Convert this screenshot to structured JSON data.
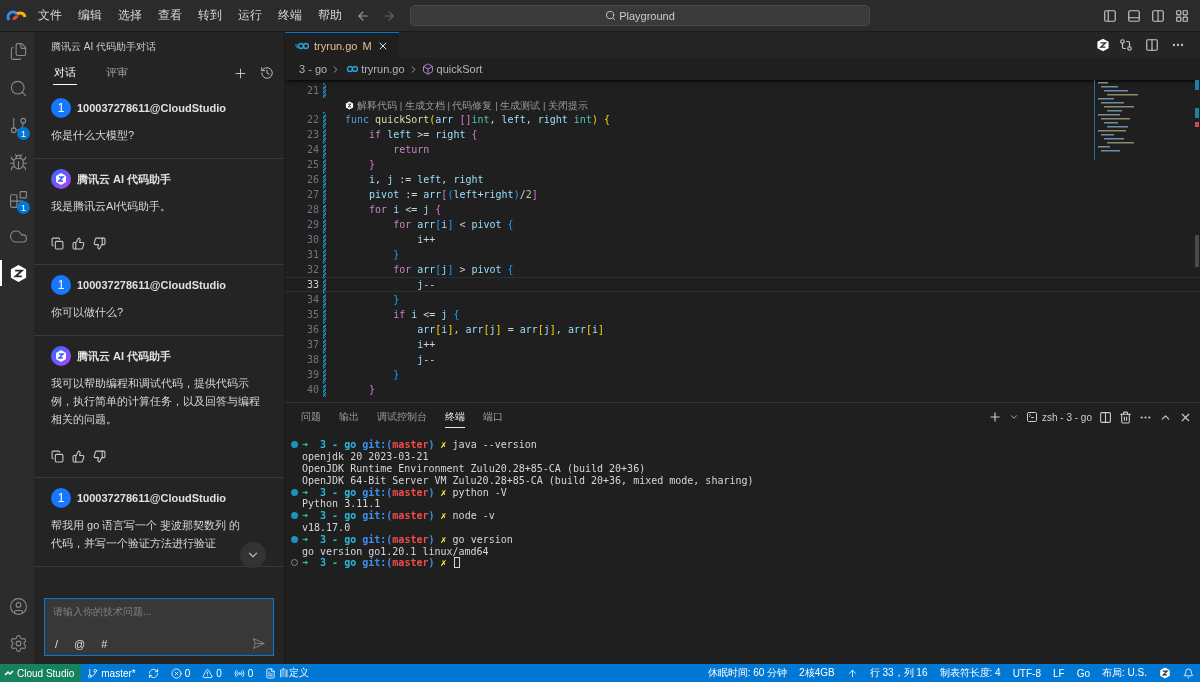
{
  "menu_bar": {
    "items": [
      "文件",
      "编辑",
      "选择",
      "查看",
      "转到",
      "运行",
      "终端",
      "帮助"
    ],
    "search": {
      "value": "Playground"
    }
  },
  "activity_bar": {
    "items": [
      {
        "kind": "files",
        "selected": false
      },
      {
        "kind": "search",
        "selected": false
      },
      {
        "kind": "source-control",
        "selected": false,
        "badge": "1"
      },
      {
        "kind": "run",
        "selected": false
      },
      {
        "kind": "extensions",
        "selected": false,
        "badge": "1"
      },
      {
        "kind": "cloud",
        "selected": false
      },
      {
        "kind": "assistant",
        "selected": true
      }
    ],
    "bottom": [
      {
        "kind": "account"
      },
      {
        "kind": "settings"
      }
    ]
  },
  "chat": {
    "title": "腾讯云 AI 代码助手对话",
    "tabs": [
      {
        "label": "对话",
        "selected": true
      },
      {
        "label": "评审",
        "selected": false
      }
    ],
    "messages": [
      {
        "kind": "user",
        "avatar": "1",
        "author": "100037278611@CloudStudio",
        "lines": [
          "你是什么大模型?"
        ]
      },
      {
        "kind": "assistant",
        "author": "腾讯云 AI 代码助手",
        "lines": [
          "我是腾讯云AI代码助手。"
        ]
      },
      {
        "kind": "user",
        "avatar": "1",
        "author": "100037278611@CloudStudio",
        "lines": [
          "你可以做什么?"
        ]
      },
      {
        "kind": "assistant",
        "author": "腾讯云 AI 代码助手",
        "lines": [
          "我可以帮助编程和调试代码，提供代码示",
          "例，执行简单的计算任务，以及回答与编程",
          "相关的问题。"
        ]
      },
      {
        "kind": "user",
        "avatar": "1",
        "author": "100037278611@CloudStudio",
        "lines": [
          "帮我用 go 语言写一个 斐波那契数列 的",
          "代码，并写一个验证方法进行验证"
        ]
      }
    ],
    "input": {
      "placeholder": "请输入你的技术问题...",
      "shortcuts": [
        "/",
        "@",
        "#"
      ]
    }
  },
  "editor": {
    "tabs": [
      {
        "name": "tryrun.go",
        "status": "M",
        "selected": true
      }
    ],
    "breadcrumb": [
      "3 - go",
      "tryrun.go",
      "quickSort"
    ],
    "lines": [
      {
        "number": "21",
        "selected": false,
        "lens": "解释代码 | 生成文档 | 代码修复 | 生成测试 | 关闭提示"
      },
      {
        "number": "22",
        "selected": false,
        "tokens": [
          {
            "text": "func ",
            "kind": "kw"
          },
          {
            "text": "quickSort",
            "kind": "fn"
          },
          {
            "text": "(",
            "kind": "b1"
          },
          {
            "text": "arr ",
            "kind": "id"
          },
          {
            "text": "[]",
            "kind": "b2"
          },
          {
            "text": "int",
            "kind": "type"
          },
          {
            "text": ", ",
            "kind": "op"
          },
          {
            "text": "left",
            "kind": "id"
          },
          {
            "text": ", ",
            "kind": "op"
          },
          {
            "text": "right ",
            "kind": "id"
          },
          {
            "text": "int",
            "kind": "type"
          },
          {
            "text": ")",
            "kind": "b1"
          },
          {
            "text": " {",
            "kind": "b1"
          }
        ]
      },
      {
        "number": "23",
        "selected": false,
        "tokens": [
          {
            "text": "    if ",
            "kind": "ctl"
          },
          {
            "text": "left ",
            "kind": "id"
          },
          {
            "text": ">= ",
            "kind": "op"
          },
          {
            "text": "right ",
            "kind": "id"
          },
          {
            "text": "{",
            "kind": "b2"
          }
        ]
      },
      {
        "number": "24",
        "selected": false,
        "tokens": [
          {
            "text": "        return",
            "kind": "ctl"
          }
        ]
      },
      {
        "number": "25",
        "selected": false,
        "tokens": [
          {
            "text": "    }",
            "kind": "b2"
          }
        ]
      },
      {
        "number": "26",
        "selected": false,
        "tokens": [
          {
            "text": "    i",
            "kind": "id"
          },
          {
            "text": ", ",
            "kind": "op"
          },
          {
            "text": "j ",
            "kind": "id"
          },
          {
            "text": ":= ",
            "kind": "op"
          },
          {
            "text": "left",
            "kind": "id"
          },
          {
            "text": ", ",
            "kind": "op"
          },
          {
            "text": "right",
            "kind": "id"
          }
        ]
      },
      {
        "number": "27",
        "selected": false,
        "tokens": [
          {
            "text": "    pivot ",
            "kind": "id"
          },
          {
            "text": ":= ",
            "kind": "op"
          },
          {
            "text": "arr",
            "kind": "id"
          },
          {
            "text": "[",
            "kind": "b2"
          },
          {
            "text": "(",
            "kind": "b3"
          },
          {
            "text": "left",
            "kind": "id"
          },
          {
            "text": "+",
            "kind": "op"
          },
          {
            "text": "right",
            "kind": "id"
          },
          {
            "text": ")",
            "kind": "b3"
          },
          {
            "text": "/",
            "kind": "op"
          },
          {
            "text": "2",
            "kind": "num"
          },
          {
            "text": "]",
            "kind": "b2"
          }
        ]
      },
      {
        "number": "28",
        "selected": false,
        "tokens": [
          {
            "text": "    for ",
            "kind": "ctl"
          },
          {
            "text": "i ",
            "kind": "id"
          },
          {
            "text": "<= ",
            "kind": "op"
          },
          {
            "text": "j ",
            "kind": "id"
          },
          {
            "text": "{",
            "kind": "b2"
          }
        ]
      },
      {
        "number": "29",
        "selected": false,
        "tokens": [
          {
            "text": "        for ",
            "kind": "ctl"
          },
          {
            "text": "arr",
            "kind": "id"
          },
          {
            "text": "[",
            "kind": "b3"
          },
          {
            "text": "i",
            "kind": "id"
          },
          {
            "text": "]",
            "kind": "b3"
          },
          {
            "text": " < ",
            "kind": "op"
          },
          {
            "text": "pivot ",
            "kind": "id"
          },
          {
            "text": "{",
            "kind": "b3"
          }
        ]
      },
      {
        "number": "30",
        "selected": false,
        "tokens": [
          {
            "text": "            i",
            "kind": "id"
          },
          {
            "text": "++",
            "kind": "op"
          }
        ]
      },
      {
        "number": "31",
        "selected": false,
        "tokens": [
          {
            "text": "        }",
            "kind": "b3"
          }
        ]
      },
      {
        "number": "32",
        "selected": false,
        "tokens": [
          {
            "text": "        for ",
            "kind": "ctl"
          },
          {
            "text": "arr",
            "kind": "id"
          },
          {
            "text": "[",
            "kind": "b3"
          },
          {
            "text": "j",
            "kind": "id"
          },
          {
            "text": "]",
            "kind": "b3"
          },
          {
            "text": " > ",
            "kind": "op"
          },
          {
            "text": "pivot ",
            "kind": "id"
          },
          {
            "text": "{",
            "kind": "b3"
          }
        ]
      },
      {
        "number": "33",
        "selected": true,
        "tokens": [
          {
            "text": "            j",
            "kind": "id"
          },
          {
            "text": "--",
            "kind": "op"
          }
        ]
      },
      {
        "number": "34",
        "selected": false,
        "tokens": [
          {
            "text": "        }",
            "kind": "b3"
          }
        ]
      },
      {
        "number": "35",
        "selected": false,
        "tokens": [
          {
            "text": "        if ",
            "kind": "ctl"
          },
          {
            "text": "i ",
            "kind": "id"
          },
          {
            "text": "<= ",
            "kind": "op"
          },
          {
            "text": "j ",
            "kind": "id"
          },
          {
            "text": "{",
            "kind": "b3"
          }
        ]
      },
      {
        "number": "36",
        "selected": false,
        "tokens": [
          {
            "text": "            arr",
            "kind": "id"
          },
          {
            "text": "[",
            "kind": "b1"
          },
          {
            "text": "i",
            "kind": "id"
          },
          {
            "text": "]",
            "kind": "b1"
          },
          {
            "text": ", ",
            "kind": "op"
          },
          {
            "text": "arr",
            "kind": "id"
          },
          {
            "text": "[",
            "kind": "b1"
          },
          {
            "text": "j",
            "kind": "id"
          },
          {
            "text": "]",
            "kind": "b1"
          },
          {
            "text": " = ",
            "kind": "op"
          },
          {
            "text": "arr",
            "kind": "id"
          },
          {
            "text": "[",
            "kind": "b1"
          },
          {
            "text": "j",
            "kind": "id"
          },
          {
            "text": "]",
            "kind": "b1"
          },
          {
            "text": ", ",
            "kind": "op"
          },
          {
            "text": "arr",
            "kind": "id"
          },
          {
            "text": "[",
            "kind": "b1"
          },
          {
            "text": "i",
            "kind": "id"
          },
          {
            "text": "]",
            "kind": "b1"
          }
        ]
      },
      {
        "number": "37",
        "selected": false,
        "tokens": [
          {
            "text": "            i",
            "kind": "id"
          },
          {
            "text": "++",
            "kind": "op"
          }
        ]
      },
      {
        "number": "38",
        "selected": false,
        "tokens": [
          {
            "text": "            j",
            "kind": "id"
          },
          {
            "text": "--",
            "kind": "op"
          }
        ]
      },
      {
        "number": "39",
        "selected": false,
        "tokens": [
          {
            "text": "        }",
            "kind": "b3"
          }
        ]
      },
      {
        "number": "40",
        "selected": false,
        "tokens": [
          {
            "text": "    }",
            "kind": "b2"
          }
        ]
      }
    ]
  },
  "panel": {
    "tabs": [
      {
        "label": "问题",
        "selected": false
      },
      {
        "label": "输出",
        "selected": false
      },
      {
        "label": "调试控制台",
        "selected": false
      },
      {
        "label": "终端",
        "selected": true
      },
      {
        "label": "端口",
        "selected": false
      }
    ],
    "terminal_name": "zsh - 3 - go",
    "lines": [
      {
        "kind": "prompt",
        "finished": true,
        "arrow": "➜",
        "dir": "3 - go",
        "git": "git:(",
        "branch": "master",
        "git_end": ")",
        "dirty": "✗",
        "command": "java --version"
      },
      {
        "kind": "output",
        "text": "openjdk 20 2023-03-21"
      },
      {
        "kind": "output",
        "text": "OpenJDK Runtime Environment Zulu20.28+85-CA (build 20+36)"
      },
      {
        "kind": "output",
        "text": "OpenJDK 64-Bit Server VM Zulu20.28+85-CA (build 20+36, mixed mode, sharing)"
      },
      {
        "kind": "prompt",
        "finished": true,
        "arrow": "➜",
        "dir": "3 - go",
        "git": "git:(",
        "branch": "master",
        "git_end": ")",
        "dirty": "✗",
        "command": "python -V"
      },
      {
        "kind": "output",
        "text": "Python 3.11.1"
      },
      {
        "kind": "prompt",
        "finished": true,
        "arrow": "➜",
        "dir": "3 - go",
        "git": "git:(",
        "branch": "master",
        "git_end": ")",
        "dirty": "✗",
        "command": "node -v"
      },
      {
        "kind": "output",
        "text": "v18.17.0"
      },
      {
        "kind": "prompt",
        "finished": true,
        "arrow": "➜",
        "dir": "3 - go",
        "git": "git:(",
        "branch": "master",
        "git_end": ")",
        "dirty": "✗",
        "command": "go version"
      },
      {
        "kind": "output",
        "text": "go version go1.20.1 linux/amd64"
      },
      {
        "kind": "prompt",
        "finished": false,
        "arrow": "➜",
        "dir": "3 - go",
        "git": "git:(",
        "branch": "master",
        "git_end": ")",
        "dirty": "✗",
        "cursor": true
      }
    ]
  },
  "status_bar": {
    "left": [
      {
        "kind": "remote",
        "text": "Cloud Studio"
      },
      {
        "kind": "branch",
        "text": "master*"
      },
      {
        "kind": "sync"
      },
      {
        "kind": "errors",
        "text": "0"
      },
      {
        "kind": "warnings",
        "text": "0"
      },
      {
        "kind": "ports",
        "text": "0"
      },
      {
        "kind": "layout",
        "text": "自定义"
      }
    ],
    "right": [
      {
        "kind": "text",
        "text": "休眠时间: 60 分钟"
      },
      {
        "kind": "text",
        "text": "2核4GB"
      },
      {
        "kind": "upload"
      },
      {
        "kind": "text",
        "text": "行 33，列 16"
      },
      {
        "kind": "text",
        "text": "制表符长度: 4"
      },
      {
        "kind": "text",
        "text": "UTF-8"
      },
      {
        "kind": "text",
        "text": "LF"
      },
      {
        "kind": "text",
        "text": "Go"
      },
      {
        "kind": "text",
        "text": "布局: U.S."
      },
      {
        "kind": "assistant"
      },
      {
        "kind": "bell"
      }
    ]
  }
}
